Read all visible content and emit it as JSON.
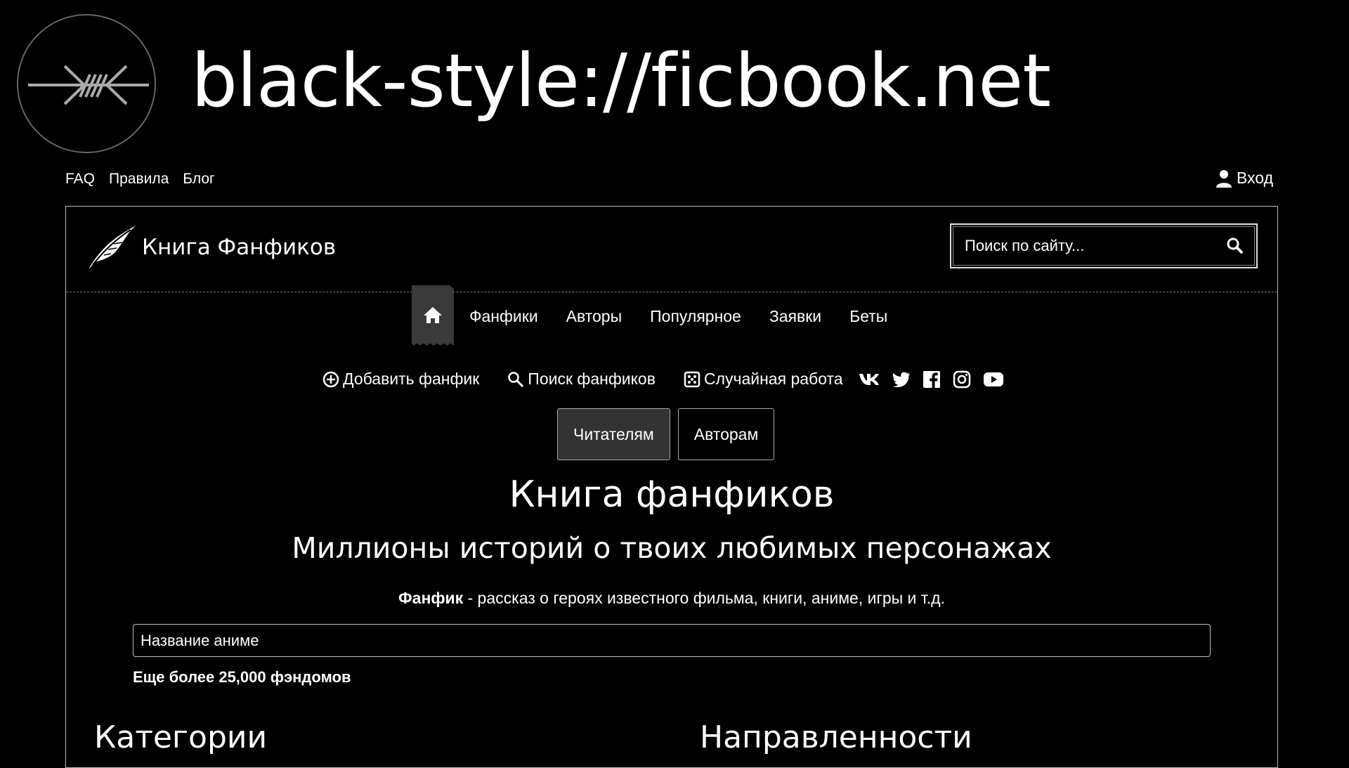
{
  "banner": {
    "title": "black-style://ficbook.net",
    "logo_icon": "barbed-wire-icon"
  },
  "top_nav": {
    "links": [
      "FAQ",
      "Правила",
      "Блог"
    ],
    "login_label": "Вход",
    "login_icon": "user-icon"
  },
  "header": {
    "site_name": "Книга Фанфиков",
    "logo_icon": "feather-icon",
    "search_placeholder": "Поиск по сайту...",
    "search_icon": "search-icon"
  },
  "main_nav": {
    "home_icon": "home-icon",
    "items": [
      "Фанфики",
      "Авторы",
      "Популярное",
      "Заявки",
      "Беты"
    ]
  },
  "actions": {
    "add_fanfic": "Добавить фанфик",
    "search_fanfics": "Поиск фанфиков",
    "random_work": "Случайная работа",
    "social_icons": [
      "vk-icon",
      "twitter-icon",
      "facebook-icon",
      "instagram-icon",
      "youtube-icon"
    ]
  },
  "audience_tabs": {
    "readers": "Читателям",
    "authors": "Авторам",
    "active": "readers"
  },
  "hero": {
    "title": "Книга фанфиков",
    "subtitle": "Миллионы историй о твоих любимых персонажах",
    "definition_term": "Фанфик",
    "definition_text": " - рассказ о героях известного фильма, книги, аниме, игры и т.д."
  },
  "fandom_search": {
    "placeholder": "Название аниме",
    "more_label": "Еще более 25,000 фэндомов"
  },
  "sections": {
    "categories": "Категории",
    "directions": "Направленности"
  },
  "colors": {
    "background": "#000000",
    "text": "#ffffff",
    "active_tab": "#333333",
    "border": "#bbbbbb"
  }
}
